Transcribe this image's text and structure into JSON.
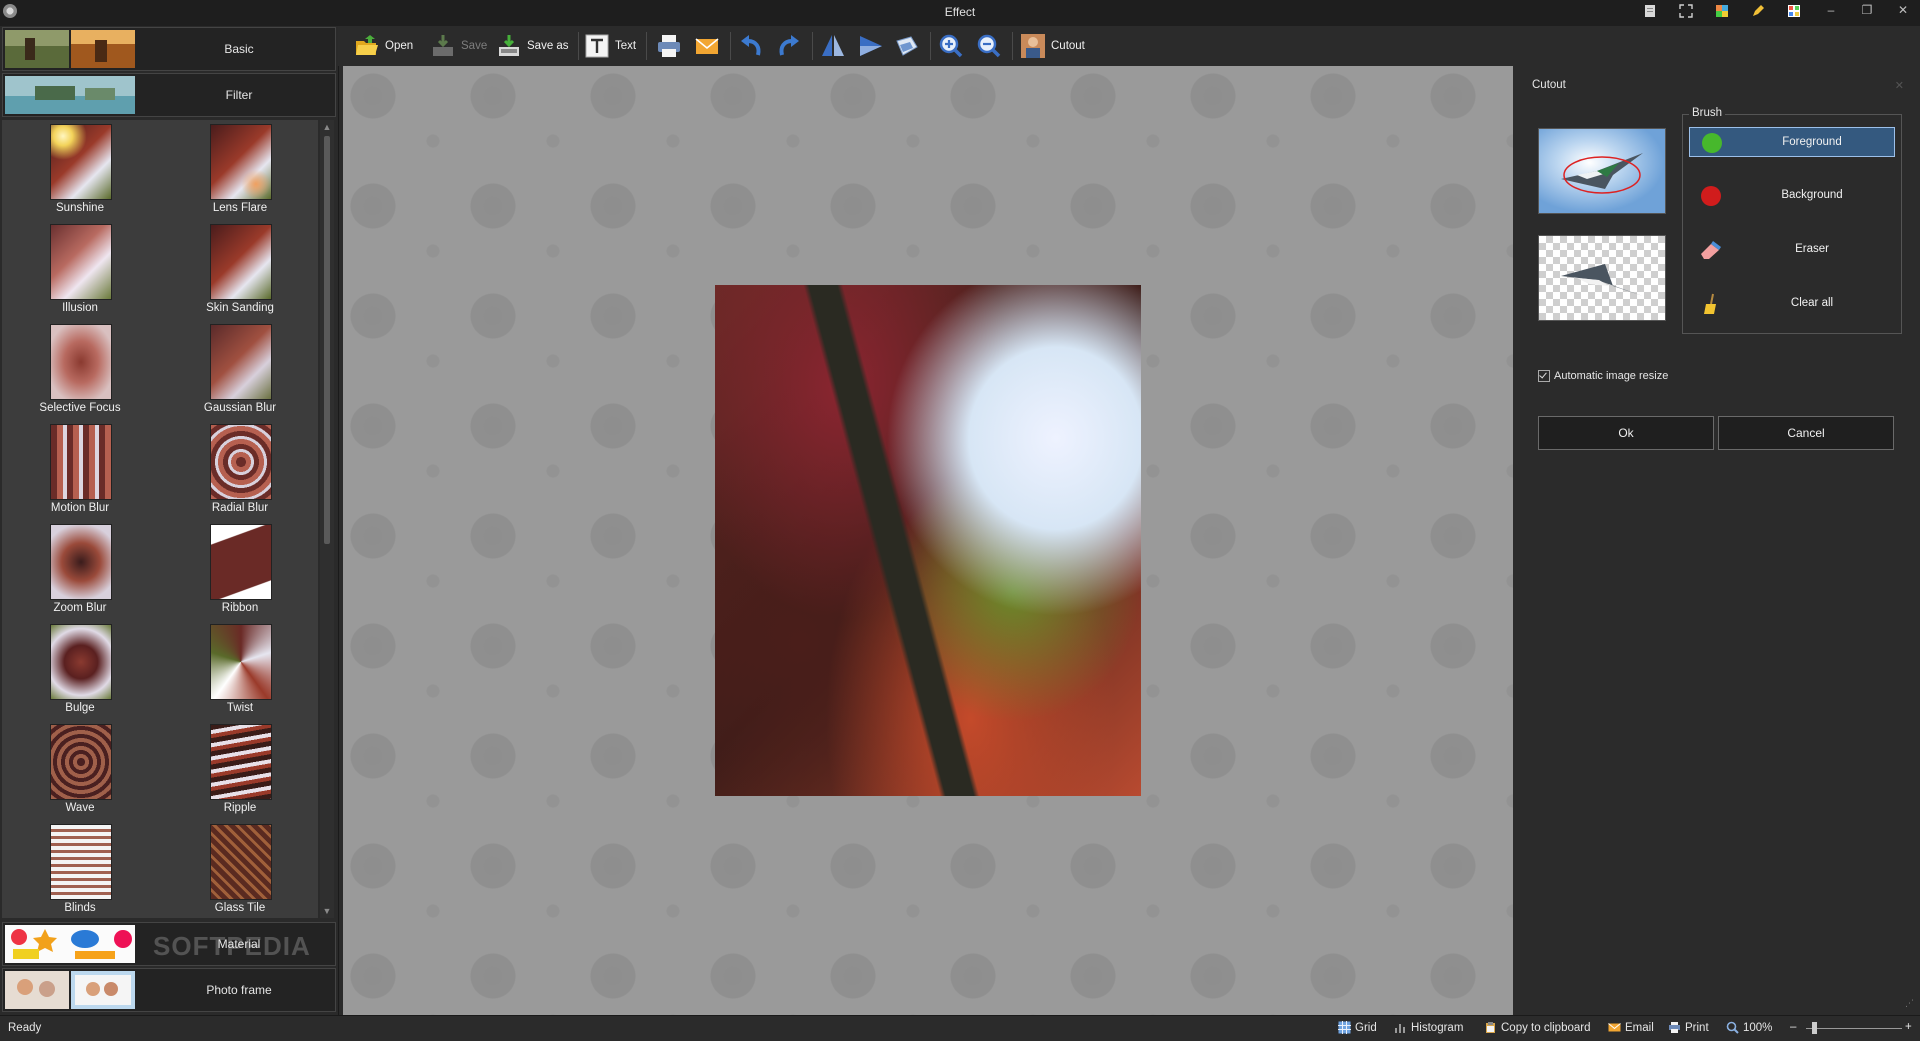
{
  "window": {
    "title": "Effect"
  },
  "left_panel": {
    "categories": {
      "basic": "Basic",
      "filter": "Filter",
      "material": "Material",
      "photo_frame": "Photo frame"
    },
    "filters": [
      "Sunshine",
      "Lens Flare",
      "Illusion",
      "Skin Sanding",
      "Selective Focus",
      "Gaussian Blur",
      "Motion Blur",
      "Radial Blur",
      "Zoom Blur",
      "Ribbon",
      "Bulge",
      "Twist",
      "Wave",
      "Ripple",
      "Blinds",
      "Glass Tile"
    ],
    "watermark": "SOFTPEDIA"
  },
  "toolbar": {
    "open": "Open",
    "save": "Save",
    "save_as": "Save as",
    "text": "Text",
    "cutout": "Cutout"
  },
  "cutout_panel": {
    "title": "Cutout",
    "brush_legend": "Brush",
    "brushes": [
      "Foreground",
      "Background",
      "Eraser",
      "Clear all"
    ],
    "auto_resize": "Automatic image resize",
    "ok": "Ok",
    "cancel": "Cancel"
  },
  "statusbar": {
    "ready": "Ready",
    "grid": "Grid",
    "histogram": "Histogram",
    "copy": "Copy to clipboard",
    "email": "Email",
    "print": "Print",
    "zoom": "100%",
    "minus": "–",
    "plus": "+"
  },
  "icons": {
    "open": "folder-open-icon",
    "save": "save-icon",
    "save_as": "save-as-icon",
    "text": "text-icon",
    "print": "printer-icon",
    "email": "envelope-icon",
    "undo": "undo-icon",
    "redo": "redo-icon",
    "flip": "flip-icon",
    "rotate": "rotate-icon",
    "transform": "transform-icon",
    "zoom_in": "zoom-in-icon",
    "zoom_out": "zoom-out-icon",
    "cutout": "cutout-icon"
  },
  "colors": {
    "selected_brush": "#34597f",
    "foreground_dot": "#47b82c",
    "background_dot": "#d11c1c"
  }
}
